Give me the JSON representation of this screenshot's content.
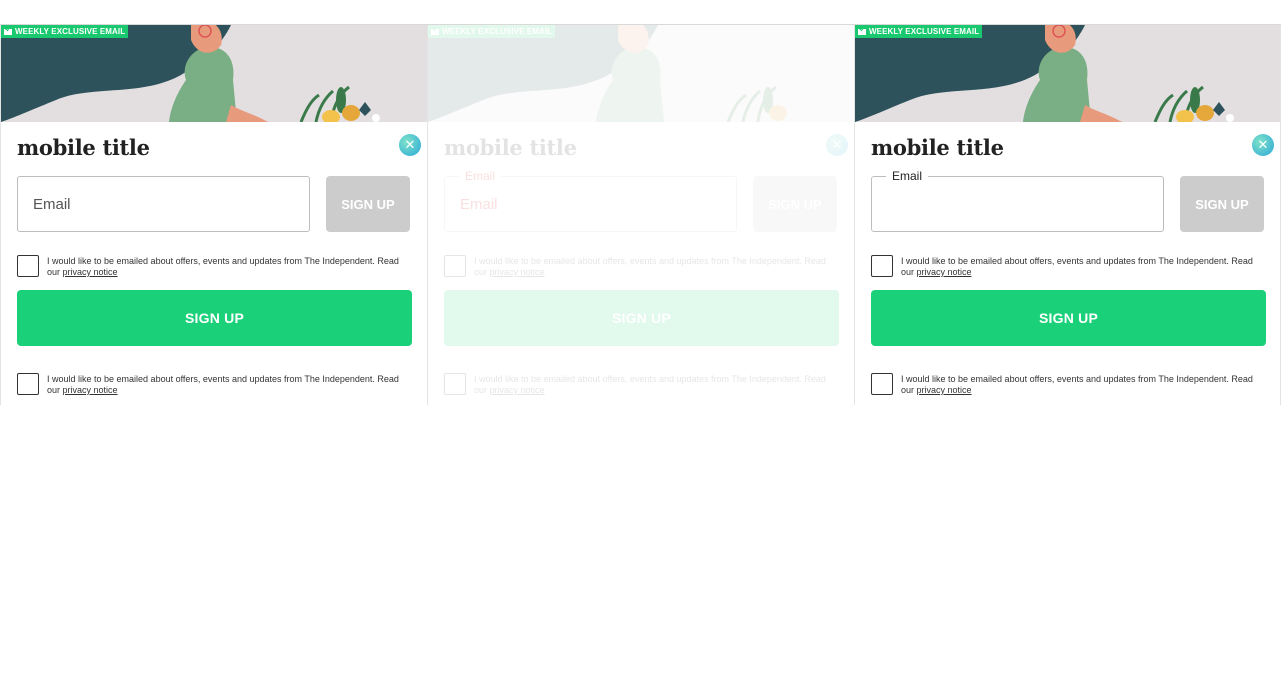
{
  "cards": [
    {
      "badge": "WEEKLY EXCLUSIVE EMAIL",
      "title": "mobile title",
      "email_label": "",
      "email_placeholder": "Email",
      "signup_small": "SIGN UP",
      "signup_big": "SIGN UP",
      "consent_text": "I would like to be emailed about offers, events and updates from The Independent. Read our ",
      "privacy_link": "privacy notice",
      "state": "default"
    },
    {
      "badge": "WEEKLY EXCLUSIVE EMAIL",
      "title": "mobile title",
      "email_label": "Email",
      "email_inline": "Email",
      "email_placeholder": "",
      "signup_small": "SIGN UP",
      "signup_big": "SIGN UP",
      "consent_text": "I would like to be emailed about offers, events and updates from The Independent. Read our ",
      "privacy_link": "privacy notice",
      "state": "transition"
    },
    {
      "badge": "WEEKLY EXCLUSIVE EMAIL",
      "title": "mobile title",
      "email_label": "Email",
      "email_placeholder": "",
      "signup_small": "SIGN UP",
      "signup_big": "SIGN UP",
      "consent_text": "I would like to be emailed about offers, events and updates from The Independent. Read our ",
      "privacy_link": "privacy notice",
      "state": "focused"
    }
  ],
  "colors": {
    "accent_green": "#1ad17a",
    "badge_green": "#1ac96f",
    "hero_teal": "#2e525b",
    "hero_bg": "#e3dfe1",
    "disabled_button": "#cccccc"
  },
  "icons": {
    "close": "eagle-logo-close-icon",
    "badge": "mail-icon"
  }
}
